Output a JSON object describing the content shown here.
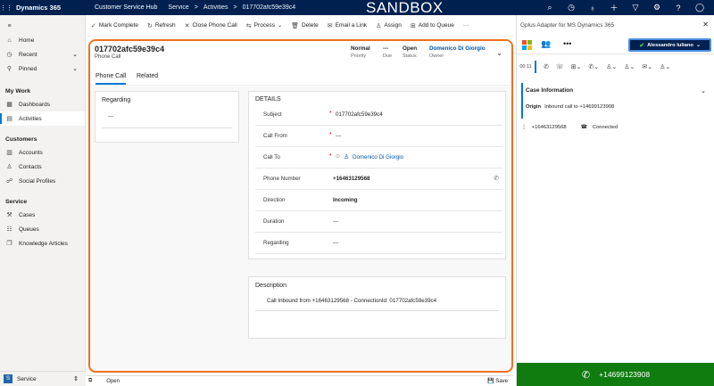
{
  "topbar": {
    "brand": "Dynamics 365",
    "app": "Customer Service Hub",
    "crumbs": [
      "Service",
      ">",
      "Activities",
      ">",
      "017702afc59e39c4"
    ],
    "sandbox": "SANDBOX"
  },
  "nav": {
    "home": "Home",
    "recent": "Recent",
    "pinned": "Pinned",
    "my_work": "My Work",
    "dashboards": "Dashboards",
    "activities": "Activities",
    "customers": "Customers",
    "accounts": "Accounts",
    "contacts": "Contacts",
    "social": "Social Profiles",
    "service": "Service",
    "cases": "Cases",
    "queues": "Queues",
    "knowledge": "Knowledge Articles",
    "area_letter": "S",
    "area_name": "Service"
  },
  "cmd": {
    "mark": "Mark Complete",
    "refresh": "Refresh",
    "close_call": "Close Phone Call",
    "process": "Process",
    "delete": "Delete",
    "email_link": "Email a Link",
    "assign": "Assign",
    "add_queue": "Add to Queue",
    "more": "···"
  },
  "record": {
    "title": "017702afc59e39c4",
    "type": "Phone Call",
    "priority_v": "Normal",
    "priority_l": "Priority",
    "due_v": "---",
    "due_l": "Due",
    "status_v": "Open",
    "status_l": "Status",
    "owner_v": "Domenico Di Giorgio",
    "owner_l": "Owner"
  },
  "tabs": {
    "phone_call": "Phone Call",
    "related": "Related"
  },
  "regarding": {
    "title": "Regarding",
    "value": "---"
  },
  "details": {
    "title": "DETAILS",
    "subject_l": "Subject",
    "subject_v": "017702afc59e39c4",
    "from_l": "Call From",
    "from_v": "---",
    "to_l": "Call To",
    "to_v": "Domenico Di Giorgio",
    "phone_l": "Phone Number",
    "phone_v": "+16463129568",
    "dir_l": "Direction",
    "dir_v": "Incoming",
    "dur_l": "Duration",
    "dur_v": "---",
    "reg_l": "Regarding",
    "reg_v": "---",
    "req": "*"
  },
  "description": {
    "title": "Description",
    "value": "Call Inbound  from +16463129568 - ConnectionId: 017702afc59e39c4"
  },
  "status": {
    "open": "Open",
    "save": "Save"
  },
  "gplus": {
    "title": "Gplus Adapter for MS Dynamics 365",
    "user": "Alessandro Iuliano",
    "timer": "00:11",
    "case_title": "Case Information",
    "origin_l": "Origin",
    "origin_v": "Inbound call to +14699123908",
    "call_number": "+16463129568",
    "call_status": "Connected",
    "footer_number": "+14699123908"
  },
  "colors": {
    "accent": "#0078d4",
    "topbar": "#002050",
    "form_border": "#f07020",
    "call_green": "#107c10"
  }
}
